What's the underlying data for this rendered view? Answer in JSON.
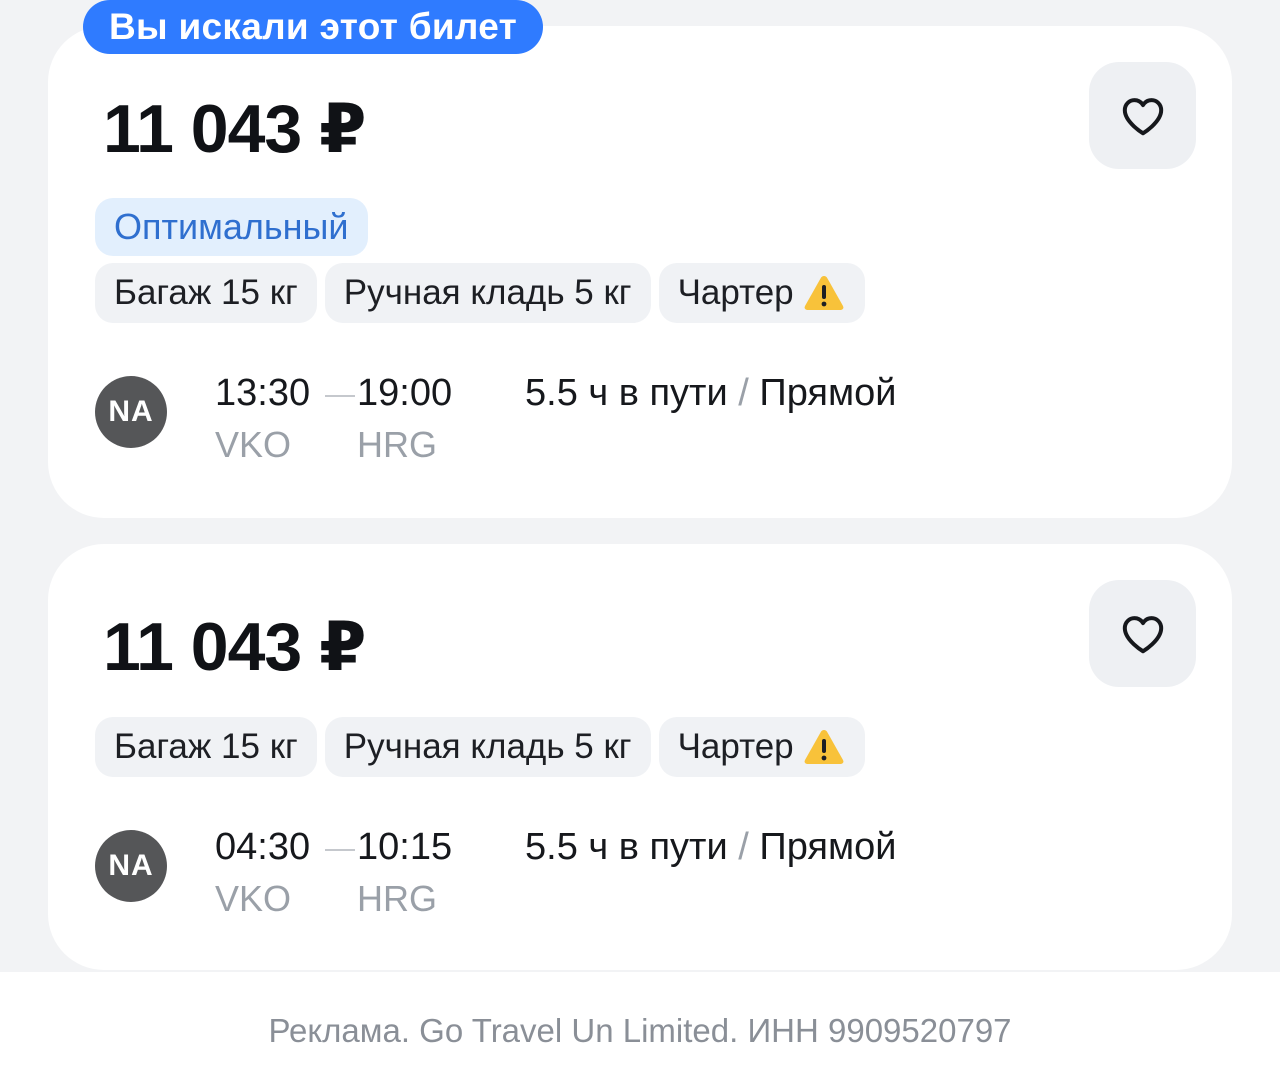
{
  "searched_label": "Вы искали этот билет",
  "tickets": [
    {
      "price": "11 043 ₽",
      "badge": "Оптимальный",
      "chips": {
        "baggage": "Багаж 15 кг",
        "hand_luggage": "Ручная кладь 5 кг",
        "charter": "Чартер"
      },
      "airline_logo_text": "NA",
      "departure_time": "13:30",
      "arrival_time": "19:00",
      "departure_airport": "VKO",
      "arrival_airport": "HRG",
      "duration": "5.5 ч в пути",
      "separator": "/",
      "stops": "Прямой"
    },
    {
      "price": "11 043 ₽",
      "chips": {
        "baggage": "Багаж 15 кг",
        "hand_luggage": "Ручная кладь 5 кг",
        "charter": "Чартер"
      },
      "airline_logo_text": "NA",
      "departure_time": "04:30",
      "arrival_time": "10:15",
      "departure_airport": "VKO",
      "arrival_airport": "HRG",
      "duration": "5.5 ч в пути",
      "separator": "/",
      "stops": "Прямой"
    }
  ],
  "ad_disclaimer": "Реклама. Go Travel Un Limited. ИНН 9909520797",
  "icons": {
    "favorite": "heart-outline-icon",
    "charter_warning": "warning-triangle-icon"
  },
  "colors": {
    "accent": "#2f7bff",
    "optimal_bg": "#e2effd",
    "optimal_text": "#2f6fcf",
    "warning": "#f8c23a",
    "airline_logo_bg": "#555658"
  }
}
